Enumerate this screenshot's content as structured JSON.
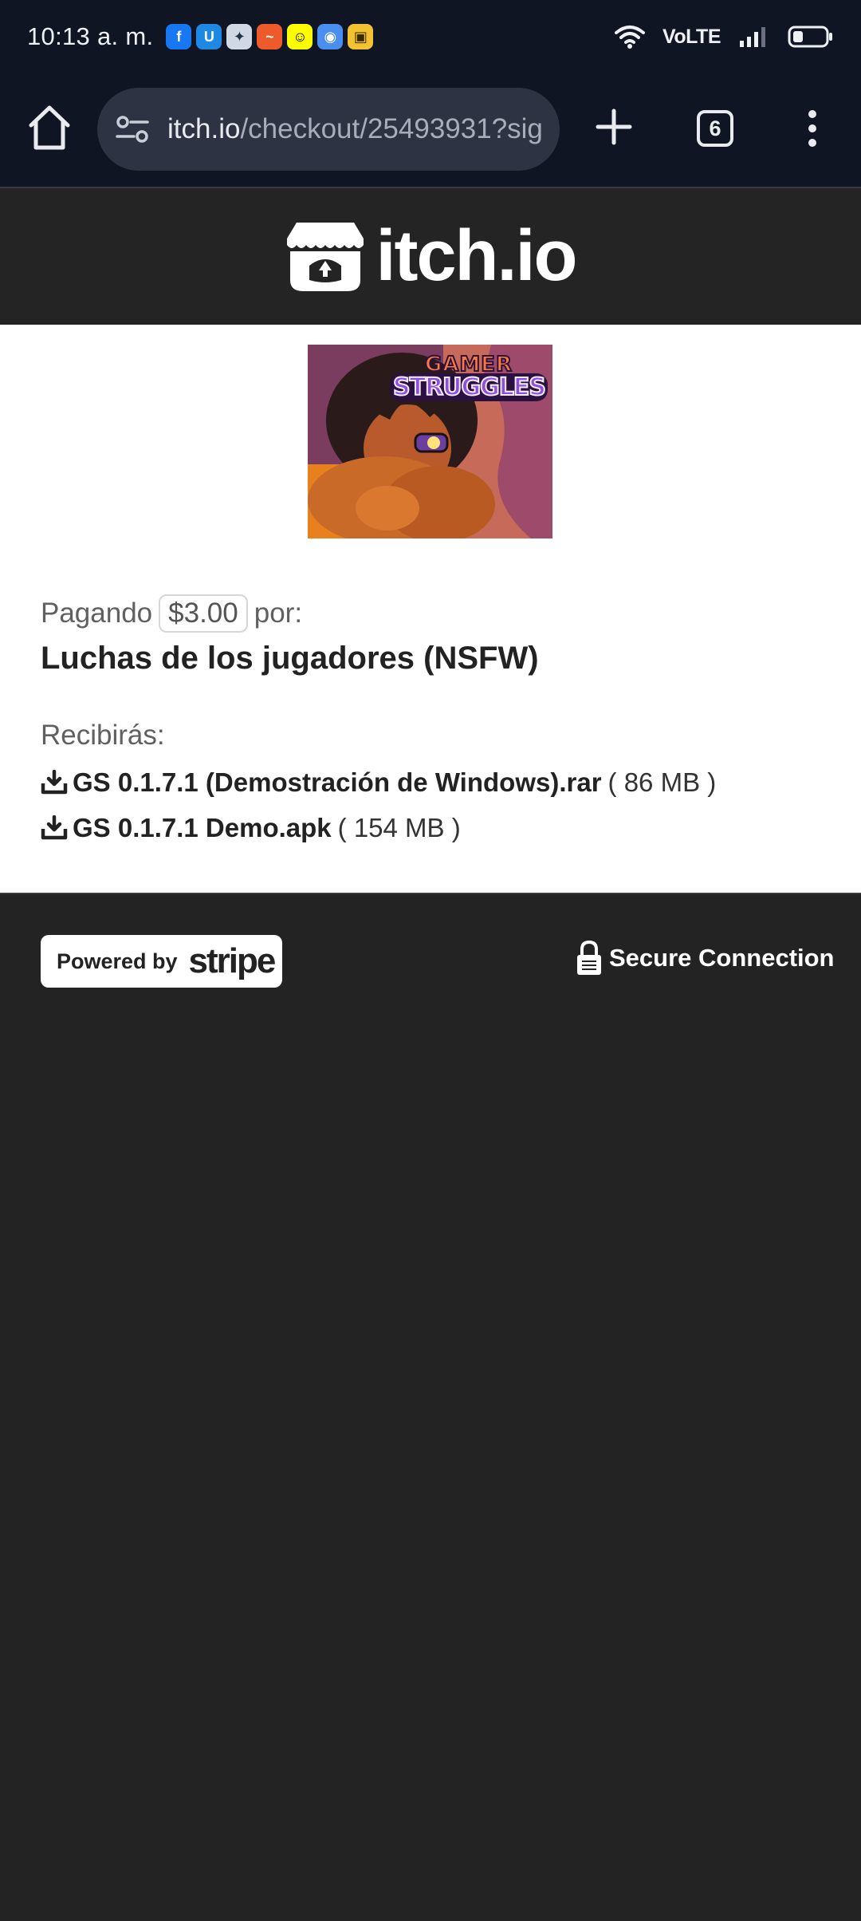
{
  "status_bar": {
    "time": "10:13 a. m.",
    "volte": "VoLTE",
    "notification_icons": [
      "facebook-icon",
      "app-store-icon",
      "game-icon",
      "mustache-app-icon",
      "snapchat-icon",
      "vpn-icon",
      "photo-app-icon"
    ]
  },
  "browser": {
    "url_host": "itch.io",
    "url_path": "/checkout/25493931?sig",
    "tab_count": "6"
  },
  "site": {
    "logo_text": "itch.io"
  },
  "checkout": {
    "paying_label": "Pagando",
    "price": "$3.00",
    "for_label": "por:",
    "game_title": "Luchas de los jugadores (NSFW)",
    "receive_label": "Recibirás:",
    "files": [
      {
        "name": "GS 0.1.7.1 (Demostración de Windows).rar",
        "size": "( 86 MB )"
      },
      {
        "name": "GS 0.1.7.1 Demo.apk",
        "size": "( 154 MB )"
      }
    ],
    "cover_logo": {
      "line1": "GAMER",
      "line2": "STRUGGLES"
    }
  },
  "footer": {
    "powered_by": "Powered by",
    "stripe": "stripe",
    "secure_connection": "Secure Connection"
  }
}
